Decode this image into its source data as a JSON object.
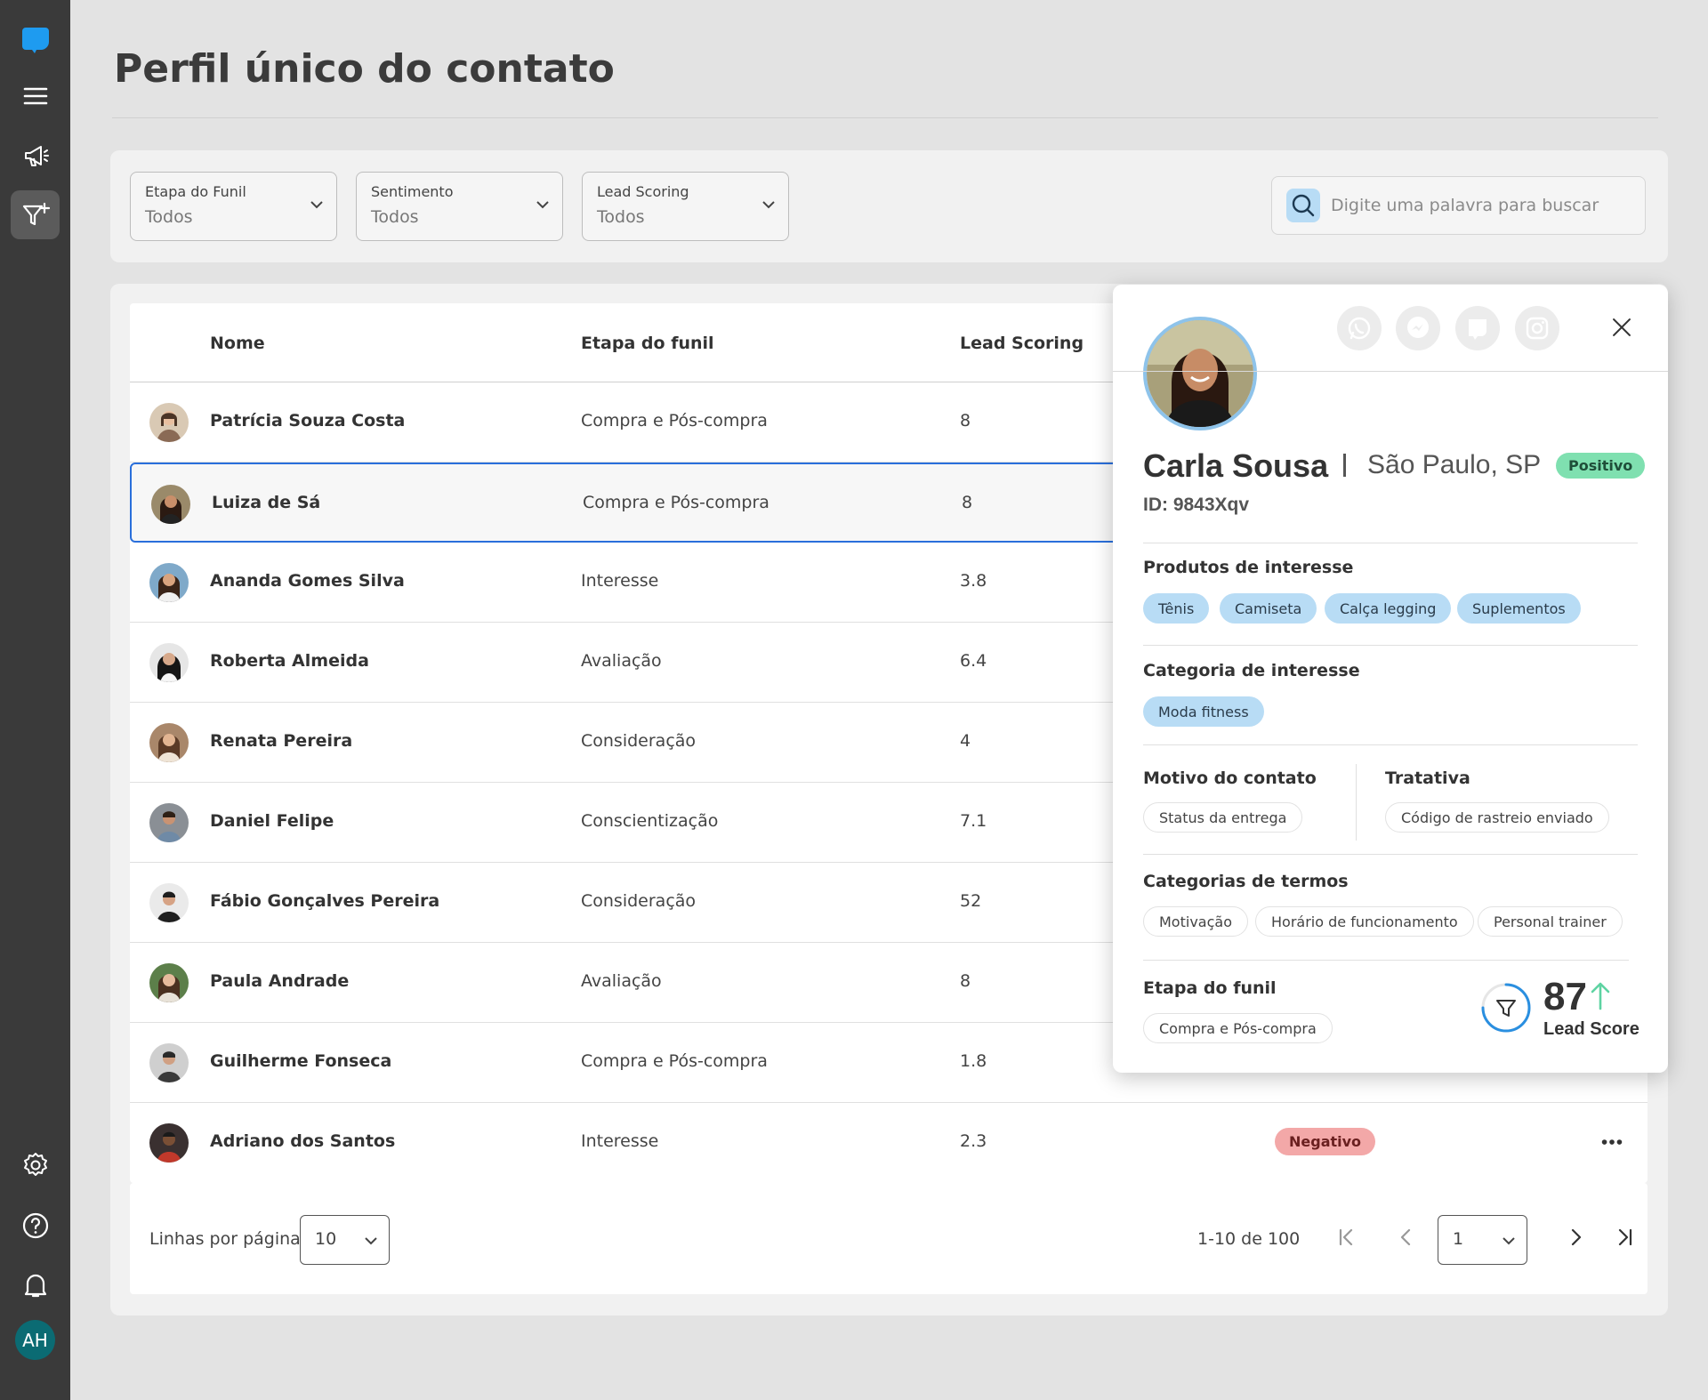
{
  "page": {
    "title": "Perfil único do contato"
  },
  "sidebar": {
    "user_initials": "AH"
  },
  "filters": [
    {
      "label": "Etapa do Funil",
      "value": "Todos"
    },
    {
      "label": "Sentimento",
      "value": "Todos"
    },
    {
      "label": "Lead Scoring",
      "value": "Todos"
    }
  ],
  "search": {
    "placeholder": "Digite uma palavra para buscar"
  },
  "table": {
    "headers": [
      "Nome",
      "Etapa do funil",
      "Lead Scoring"
    ],
    "rows": [
      {
        "name": "Patrícia Souza Costa",
        "stage": "Compra e Pós-compra",
        "score": "8"
      },
      {
        "name": "Luiza de Sá",
        "stage": "Compra e Pós-compra",
        "score": "8"
      },
      {
        "name": "Ananda Gomes Silva",
        "stage": "Interesse",
        "score": "3.8"
      },
      {
        "name": "Roberta Almeida",
        "stage": "Avaliação",
        "score": "6.4"
      },
      {
        "name": "Renata Pereira",
        "stage": "Consideração",
        "score": "4"
      },
      {
        "name": "Daniel Felipe",
        "stage": "Conscientização",
        "score": "7.1"
      },
      {
        "name": "Fábio Gonçalves Pereira",
        "stage": "Consideração",
        "score": "52"
      },
      {
        "name": "Paula Andrade",
        "stage": "Avaliação",
        "score": "8"
      },
      {
        "name": "Guilherme Fonseca",
        "stage": "Compra e Pós-compra",
        "score": "1.8"
      },
      {
        "name": "Adriano dos Santos",
        "stage": "Interesse",
        "score": "2.3",
        "sentiment": "Negativo"
      }
    ]
  },
  "pagination": {
    "rows_label": "Linhas por página",
    "rows_per_page": "10",
    "range": "1-10 de 100",
    "current_page": "1"
  },
  "profile": {
    "name": "Carla Sousa",
    "city": "São Paulo, SP",
    "sentiment": "Positivo",
    "id": "ID: 9843Xqv",
    "products_title": "Produtos de interesse",
    "products": [
      "Tênis",
      "Camiseta",
      "Calça legging",
      "Suplementos"
    ],
    "category_title": "Categoria de interesse",
    "category": "Moda fitness",
    "reason_title": "Motivo do contato",
    "reason": "Status da entrega",
    "treatment_title": "Tratativa",
    "treatment": "Código de rastreio enviado",
    "terms_title": "Categorias de termos",
    "terms": [
      "Motivação",
      "Horário de funcionamento",
      "Personal trainer"
    ],
    "funnel_title": "Etapa do funil",
    "funnel_stage": "Compra e Pós-compra",
    "lead_score": "87",
    "lead_score_label": "Lead Score"
  },
  "colors": {
    "sidebar": "#3a3a3a",
    "accent_blue": "#2a6fdb",
    "chip_blue": "#b8dcf5",
    "positive": "#7fe0b0",
    "negative": "#f3a8a8"
  }
}
